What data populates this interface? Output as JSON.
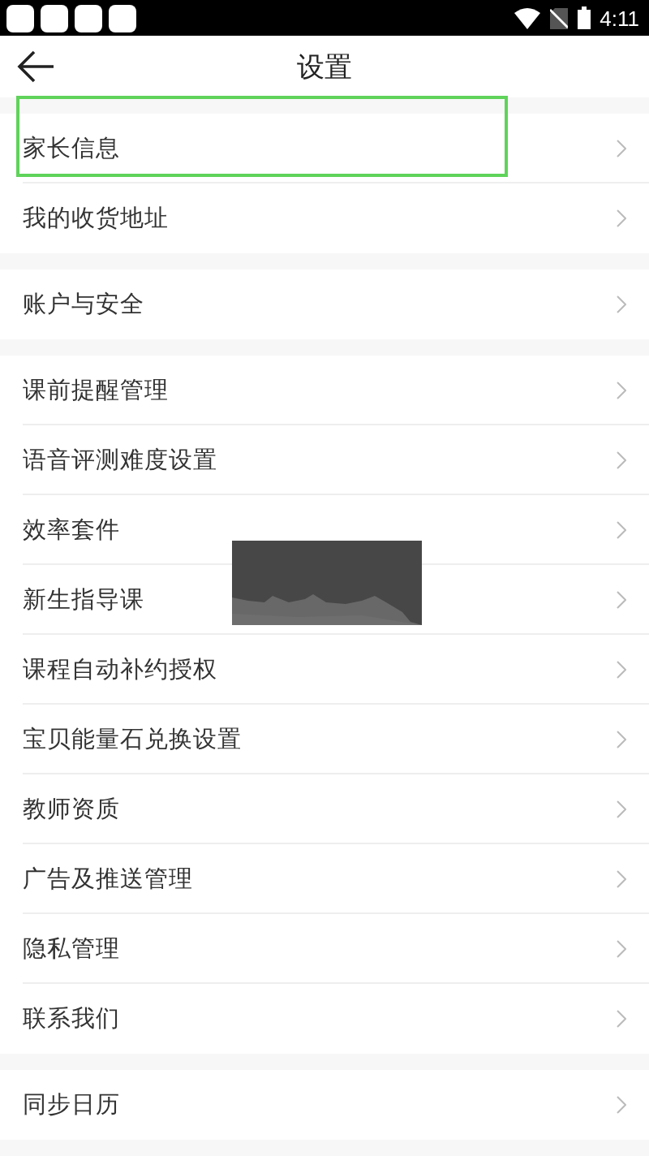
{
  "status_bar": {
    "time": "4:11"
  },
  "header": {
    "title": "设置"
  },
  "groups": [
    {
      "items": [
        {
          "label": "家长信息",
          "highlighted": true
        },
        {
          "label": "我的收货地址",
          "highlighted": false
        }
      ]
    },
    {
      "items": [
        {
          "label": "账户与安全",
          "highlighted": false
        }
      ]
    },
    {
      "items": [
        {
          "label": "课前提醒管理",
          "highlighted": false
        },
        {
          "label": "语音评测难度设置",
          "highlighted": false
        },
        {
          "label": "效率套件",
          "highlighted": false
        },
        {
          "label": "新生指导课",
          "highlighted": false
        },
        {
          "label": "课程自动补约授权",
          "highlighted": false
        },
        {
          "label": "宝贝能量石兑换设置",
          "highlighted": false
        },
        {
          "label": "教师资质",
          "highlighted": false
        },
        {
          "label": "广告及推送管理",
          "highlighted": false
        },
        {
          "label": "隐私管理",
          "highlighted": false
        },
        {
          "label": "联系我们",
          "highlighted": false
        }
      ]
    },
    {
      "items": [
        {
          "label": "同步日历",
          "highlighted": false
        }
      ]
    }
  ]
}
